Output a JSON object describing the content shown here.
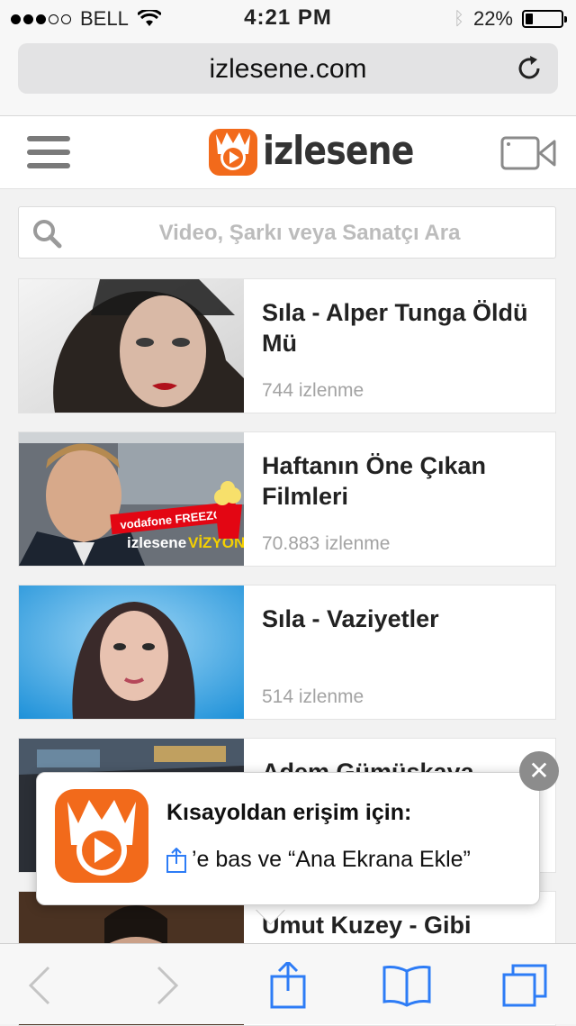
{
  "status_bar": {
    "carrier": "BELL",
    "time": "4:21 PM",
    "battery_percent": "22%",
    "battery_level": 0.22,
    "signal_filled": 3,
    "signal_total": 5
  },
  "address_bar": {
    "url": "izlesene.com",
    "reload_icon": "reload-icon"
  },
  "site_header": {
    "logo_text": "izlesene",
    "menu_icon": "hamburger-menu-icon",
    "camera_icon": "video-camera-icon"
  },
  "search": {
    "placeholder": "Video, Şarkı veya Sanatçı Ara"
  },
  "videos": [
    {
      "title": "Sıla - Alper Tunga Öldü Mü",
      "views": "744 izlenme"
    },
    {
      "title": "Haftanın Öne Çıkan Filmleri",
      "views": "70.883 izlenme"
    },
    {
      "title": "Sıla - Vaziyetler",
      "views": "514 izlenme"
    },
    {
      "title": "Adem Gümüşkaya",
      "views": ""
    },
    {
      "title": "Umut Kuzey - Gibi",
      "views": ""
    }
  ],
  "thumb_overlays": {
    "vodafone": "vodafone FREEZONE",
    "vizyon_brand": "izlesene",
    "vizyon": "VİZYON"
  },
  "popup": {
    "title": "Kısayoldan erişim için:",
    "message": "’e bas ve “Ana Ekrana Ekle”",
    "close_label": "✕"
  },
  "colors": {
    "brand_orange": "#f26a1b",
    "ios_blue": "#2d7cf6",
    "toolbar_gray": "#f7f7f7"
  }
}
